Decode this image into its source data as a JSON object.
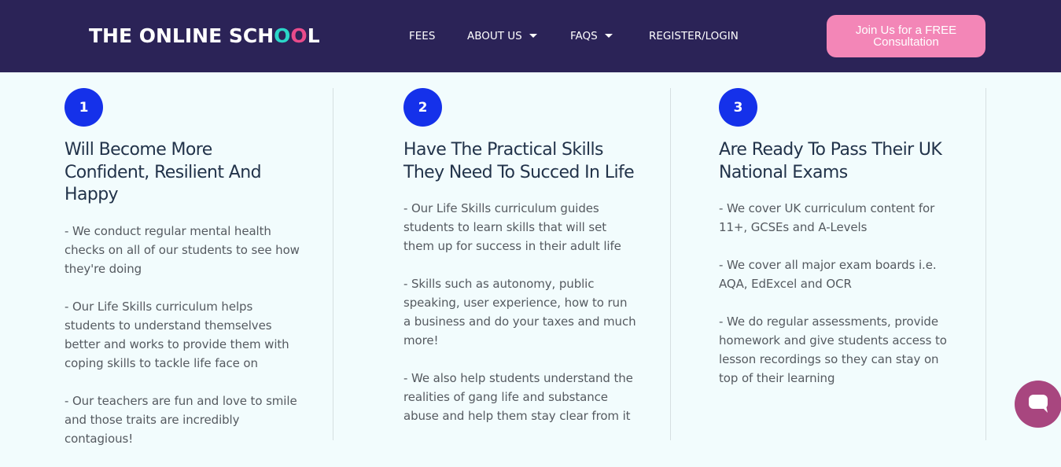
{
  "header": {
    "logo": {
      "part1": "THE ONLINE SCH",
      "o1": "O",
      "o2": "O",
      "part2": "L"
    },
    "nav": {
      "fees": "FEES",
      "about": "ABOUT US",
      "faqs": "FAQS",
      "register": "REGISTER/LOGIN"
    },
    "cta_label": "Join Us for a FREE Consultation"
  },
  "columns": [
    {
      "number": "1",
      "title": "Will Become More Confident, Resilient And Happy",
      "points": [
        "- We conduct regular mental health checks on all of our students to see how they're doing",
        "- Our Life Skills curriculum helps students to understand themselves better and works to provide them with coping skills to tackle life face on",
        "- Our teachers are fun and love to smile and those traits are incredibly contagious!"
      ]
    },
    {
      "number": "2",
      "title": "Have The Practical Skills They Need To Succed In Life",
      "points": [
        "- Our Life Skills curriculum guides students to learn skills that will set them up for success in their adult life",
        "- Skills such as autonomy, public speaking, user experience, how to run a business and do your taxes and much more!",
        "- We also help students understand the realities of gang life and substance abuse and help them stay clear from it"
      ]
    },
    {
      "number": "3",
      "title": "Are Ready To Pass Their UK National Exams",
      "points": [
        "- We cover UK curriculum content for 11+, GCSEs and A-Levels",
        "- We cover all major exam boards i.e. AQA, EdExcel and OCR",
        "- We do regular assessments, provide homework and give students access to lesson recordings so they can stay on top of their learning"
      ]
    }
  ],
  "colors": {
    "header_bg": "#2b2357",
    "cta_bg": "#f386b7",
    "number_badge": "#1531ea",
    "page_bg": "#f2fcfd",
    "chat_bubble": "#a8467f"
  },
  "icons": {
    "chat": "chat-bubble-icon",
    "dropdown": "caret-down-icon"
  }
}
